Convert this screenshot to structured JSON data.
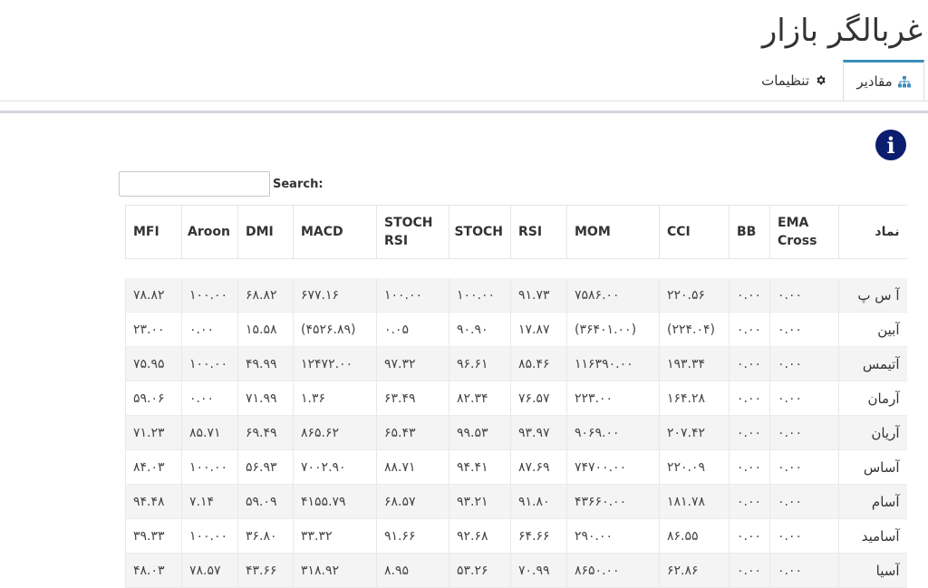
{
  "header": {
    "title": "غربالگر بازار"
  },
  "tabs": [
    {
      "label": "مقادیر",
      "icon": "sitemap-icon",
      "active": true
    },
    {
      "label": "تنظیمات",
      "icon": "gear-icon",
      "active": false
    }
  ],
  "info_icon": {
    "glyph": "i"
  },
  "search": {
    "label": "Search:",
    "value": "",
    "placeholder": ""
  },
  "table": {
    "columns": [
      "نماد",
      "EMA Cross",
      "BB",
      "CCI",
      "MOM",
      "RSI",
      "STOCH",
      "STOCH RSI",
      "MACD",
      "DMI",
      "Aroon",
      "MFI"
    ],
    "rows": [
      {
        "symbol": "آ س پ",
        "ema": "۰.۰۰",
        "bb": "۰.۰۰",
        "cci": "۲۲۰.۵۶",
        "mom": "۷۵۸۶.۰۰",
        "rsi": "۹۱.۷۳",
        "stoch": "۱۰۰.۰۰",
        "stochrsi": "۱۰۰.۰۰",
        "macd": "۶۷۷.۱۶",
        "dmi": "۶۸.۸۲",
        "aroon": "۱۰۰.۰۰",
        "mfi": "۷۸.۸۲"
      },
      {
        "symbol": "آبین",
        "ema": "۰.۰۰",
        "bb": "۰.۰۰",
        "cci": "(۲۲۴.۰۴)",
        "mom": "(۳۶۴۰۱.۰۰)",
        "rsi": "۱۷.۸۷",
        "stoch": "۹۰.۹۰",
        "stochrsi": "۰.۰۵",
        "macd": "(۴۵۲۶.۸۹)",
        "dmi": "۱۵.۵۸",
        "aroon": "۰.۰۰",
        "mfi": "۲۳.۰۰"
      },
      {
        "symbol": "آتیمس",
        "ema": "۰.۰۰",
        "bb": "۰.۰۰",
        "cci": "۱۹۳.۳۴",
        "mom": "۱۱۶۳۹۰.۰۰",
        "rsi": "۸۵.۴۶",
        "stoch": "۹۶.۶۱",
        "stochrsi": "۹۷.۳۲",
        "macd": "۱۲۴۷۲.۰۰",
        "dmi": "۴۹.۹۹",
        "aroon": "۱۰۰.۰۰",
        "mfi": "۷۵.۹۵"
      },
      {
        "symbol": "آرمان",
        "ema": "۰.۰۰",
        "bb": "۰.۰۰",
        "cci": "۱۶۴.۲۸",
        "mom": "۲۲۳.۰۰",
        "rsi": "۷۶.۵۷",
        "stoch": "۸۲.۳۴",
        "stochrsi": "۶۳.۴۹",
        "macd": "۱.۳۶",
        "dmi": "۷۱.۹۹",
        "aroon": "۰.۰۰",
        "mfi": "۵۹.۰۶"
      },
      {
        "symbol": "آریان",
        "ema": "۰.۰۰",
        "bb": "۰.۰۰",
        "cci": "۲۰۷.۴۲",
        "mom": "۹۰۶۹.۰۰",
        "rsi": "۹۳.۹۷",
        "stoch": "۹۹.۵۳",
        "stochrsi": "۶۵.۴۳",
        "macd": "۸۶۵.۶۲",
        "dmi": "۶۹.۴۹",
        "aroon": "۸۵.۷۱",
        "mfi": "۷۱.۲۳"
      },
      {
        "symbol": "آساس",
        "ema": "۰.۰۰",
        "bb": "۰.۰۰",
        "cci": "۲۲۰.۰۹",
        "mom": "۷۴۷۰۰.۰۰",
        "rsi": "۸۷.۶۹",
        "stoch": "۹۴.۴۱",
        "stochrsi": "۸۸.۷۱",
        "macd": "۷۰۰۲.۹۰",
        "dmi": "۵۶.۹۳",
        "aroon": "۱۰۰.۰۰",
        "mfi": "۸۴.۰۳"
      },
      {
        "symbol": "آسام",
        "ema": "۰.۰۰",
        "bb": "۰.۰۰",
        "cci": "۱۸۱.۷۸",
        "mom": "۴۳۶۶۰.۰۰",
        "rsi": "۹۱.۸۰",
        "stoch": "۹۳.۲۱",
        "stochrsi": "۶۸.۵۷",
        "macd": "۴۱۵۵.۷۹",
        "dmi": "۵۹.۰۹",
        "aroon": "۷.۱۴",
        "mfi": "۹۴.۴۸"
      },
      {
        "symbol": "آسامید",
        "ema": "۰.۰۰",
        "bb": "۰.۰۰",
        "cci": "۸۶.۵۵",
        "mom": "۲۹۰.۰۰",
        "rsi": "۶۴.۶۶",
        "stoch": "۹۲.۶۸",
        "stochrsi": "۹۱.۶۶",
        "macd": "۳۳.۳۲",
        "dmi": "۳۶.۸۰",
        "aroon": "۱۰۰.۰۰",
        "mfi": "۳۹.۳۳"
      },
      {
        "symbol": "آسیا",
        "ema": "۰.۰۰",
        "bb": "۰.۰۰",
        "cci": "۶۲.۸۶",
        "mom": "۸۶۵۰.۰۰",
        "rsi": "۷۰.۹۹",
        "stoch": "۵۳.۲۶",
        "stochrsi": "۸.۹۵",
        "macd": "۳۱۸.۹۲",
        "dmi": "۴۳.۶۶",
        "aroon": "۷۸.۵۷",
        "mfi": "۴۸.۰۳"
      }
    ]
  },
  "colors": {
    "accent": "#3c8dbc",
    "negative": "#d33434",
    "info_icon": "#0b1d6e"
  }
}
